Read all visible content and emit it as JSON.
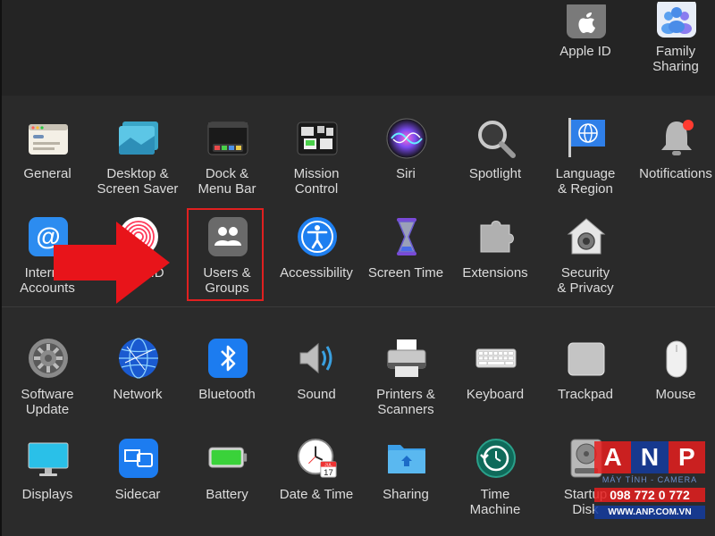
{
  "top_row": [
    {
      "key": "apple-id",
      "label": "Apple ID",
      "icon": "apple-icon"
    },
    {
      "key": "family-sharing",
      "label": "Family\nSharing",
      "icon": "family-icon"
    }
  ],
  "row1": [
    {
      "key": "general",
      "label": "General",
      "icon": "general-icon"
    },
    {
      "key": "desktop-screen-saver",
      "label": "Desktop &\nScreen Saver",
      "icon": "desktop-icon"
    },
    {
      "key": "dock-menu-bar",
      "label": "Dock &\nMenu Bar",
      "icon": "dock-icon"
    },
    {
      "key": "mission-control",
      "label": "Mission\nControl",
      "icon": "mission-control-icon"
    },
    {
      "key": "siri",
      "label": "Siri",
      "icon": "siri-icon"
    },
    {
      "key": "spotlight",
      "label": "Spotlight",
      "icon": "magnifier-icon"
    },
    {
      "key": "language-region",
      "label": "Language\n& Region",
      "icon": "flag-globe-icon"
    },
    {
      "key": "notifications",
      "label": "Notifications",
      "icon": "bell-icon"
    }
  ],
  "row2": [
    {
      "key": "internet-accounts",
      "label": "Internet\nAccounts",
      "icon": "at-sign-icon"
    },
    {
      "key": "touch-id",
      "label": "Touch ID",
      "icon": "fingerprint-icon"
    },
    {
      "key": "users-groups",
      "label": "Users &\nGroups",
      "icon": "users-icon"
    },
    {
      "key": "accessibility",
      "label": "Accessibility",
      "icon": "accessibility-icon"
    },
    {
      "key": "screen-time",
      "label": "Screen Time",
      "icon": "hourglass-icon"
    },
    {
      "key": "extensions",
      "label": "Extensions",
      "icon": "puzzle-icon"
    },
    {
      "key": "security-privacy",
      "label": "Security\n& Privacy",
      "icon": "house-lock-icon"
    }
  ],
  "row3": [
    {
      "key": "software-update",
      "label": "Software\nUpdate",
      "icon": "gear-icon"
    },
    {
      "key": "network",
      "label": "Network",
      "icon": "globe-icon"
    },
    {
      "key": "bluetooth",
      "label": "Bluetooth",
      "icon": "bluetooth-icon"
    },
    {
      "key": "sound",
      "label": "Sound",
      "icon": "speaker-icon"
    },
    {
      "key": "printers-scanners",
      "label": "Printers &\nScanners",
      "icon": "printer-icon"
    },
    {
      "key": "keyboard",
      "label": "Keyboard",
      "icon": "keyboard-icon"
    },
    {
      "key": "trackpad",
      "label": "Trackpad",
      "icon": "trackpad-icon"
    },
    {
      "key": "mouse",
      "label": "Mouse",
      "icon": "mouse-icon"
    }
  ],
  "row4": [
    {
      "key": "displays",
      "label": "Displays",
      "icon": "display-icon"
    },
    {
      "key": "sidecar",
      "label": "Sidecar",
      "icon": "sidecar-icon"
    },
    {
      "key": "battery",
      "label": "Battery",
      "icon": "battery-icon"
    },
    {
      "key": "date-time",
      "label": "Date & Time",
      "icon": "clock-icon"
    },
    {
      "key": "sharing",
      "label": "Sharing",
      "icon": "folder-icon"
    },
    {
      "key": "time-machine",
      "label": "Time\nMachine",
      "icon": "time-machine-icon"
    },
    {
      "key": "startup-disk",
      "label": "Startup\nDisk",
      "icon": "disk-icon"
    }
  ],
  "calendar": {
    "month": "JUL",
    "day": "17"
  },
  "watermark": {
    "letters": [
      "A",
      "N",
      "P"
    ],
    "subtitle": "MÁY TÍNH - CAMERA",
    "phone": "098 772 0 772",
    "website": "WWW.ANP.COM.VN"
  },
  "colors": {
    "highlight": "#e02020",
    "arrow": "#e8141a",
    "label": "#dcdcdc",
    "background": "#2b2b2b"
  }
}
